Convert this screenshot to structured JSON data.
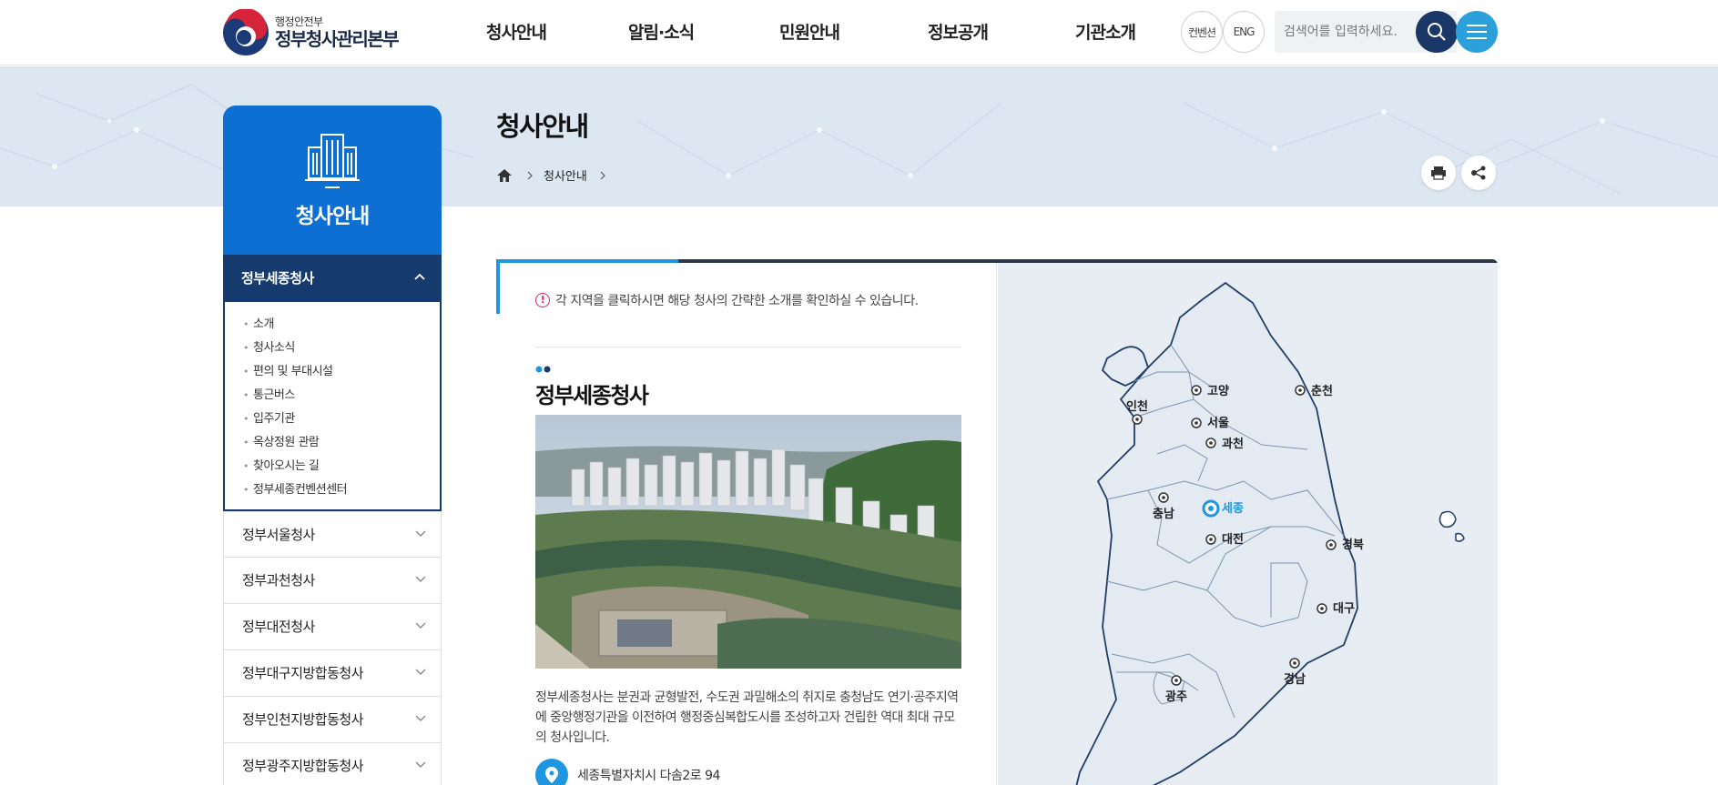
{
  "header": {
    "logo_sub": "행정안전부",
    "logo_main": "정부청사관리본부",
    "nav": [
      "청사안내",
      "알림·소식",
      "민원안내",
      "정보공개",
      "기관소개"
    ],
    "convention": "컨벤션",
    "eng": "ENG",
    "search_placeholder": "검색어를 입력하세요."
  },
  "sidebar": {
    "title": "청사안내",
    "open_item": "정부세종청사",
    "sub_items": [
      "소개",
      "청사소식",
      "편의 및 부대시설",
      "통근버스",
      "입주기관",
      "옥상정원 관람",
      "찾아오시는 길",
      "정부세종컨벤션센터"
    ],
    "items": [
      "정부서울청사",
      "정부과천청사",
      "정부대전청사",
      "정부대구지방합동청사",
      "정부인천지방합동청사",
      "정부광주지방합동청사"
    ]
  },
  "content": {
    "title": "청사안내",
    "breadcrumb": [
      "청사안내"
    ],
    "notice": "각 지역을 클릭하시면 해당 청사의 간략한 소개를 확인하실 수 있습니다.",
    "building_name": "정부세종청사",
    "description": "정부세종청사는 분권과 균형발전, 수도권 과밀해소의 취지로 충청남도 연기·공주지역에 중앙행정기관을 이전하여 행정중심복합도시를 조성하고자 건립한 역대 최대 규모의 청사입니다.",
    "address": "세종특별자치시 다솜2로 94"
  },
  "map": {
    "selected": "세종",
    "cities": [
      "인천",
      "고양",
      "서울",
      "과천",
      "춘천",
      "충남",
      "세종",
      "대전",
      "경북",
      "대구",
      "경남",
      "광주"
    ]
  },
  "colors": {
    "primary_blue": "#0c6fd1",
    "navy": "#163b6e",
    "accent": "#1e96e0",
    "menu_button": "#2ba0db"
  }
}
